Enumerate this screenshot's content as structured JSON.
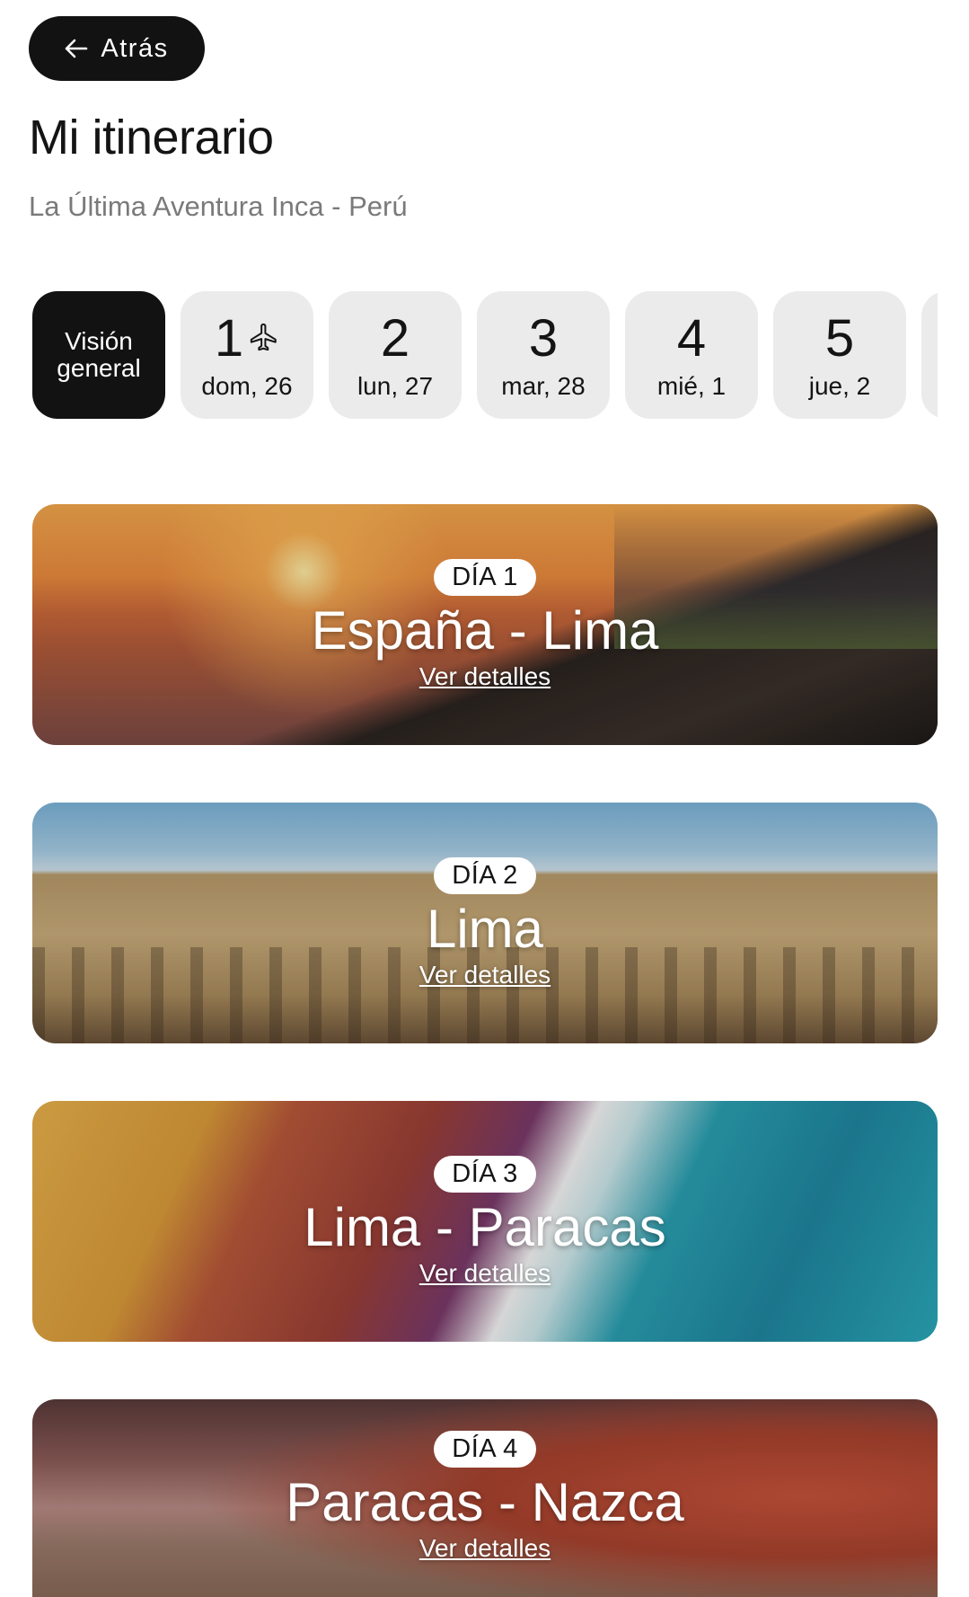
{
  "header": {
    "back_label": "Atrás",
    "title": "Mi itinerario",
    "subtitle": "La Última Aventura Inca - Perú"
  },
  "tabs": {
    "overview_label": "Visión\ngeneral",
    "days": [
      {
        "num": "1",
        "date": "dom, 26",
        "icon": "airplane-icon"
      },
      {
        "num": "2",
        "date": "lun, 27"
      },
      {
        "num": "3",
        "date": "mar, 28"
      },
      {
        "num": "4",
        "date": "mié, 1"
      },
      {
        "num": "5",
        "date": "jue, 2"
      }
    ]
  },
  "cards": [
    {
      "badge": "DÍA 1",
      "title": "España - Lima",
      "link": "Ver detalles"
    },
    {
      "badge": "DÍA 2",
      "title": "Lima",
      "link": "Ver detalles"
    },
    {
      "badge": "DÍA 3",
      "title": "Lima - Paracas",
      "link": "Ver detalles"
    },
    {
      "badge": "DÍA 4",
      "title": "Paracas - Nazca",
      "link": "Ver detalles"
    }
  ],
  "colors": {
    "dark": "#121212",
    "tab_bg": "#ebebeb",
    "subtitle": "#7a7a7a"
  }
}
